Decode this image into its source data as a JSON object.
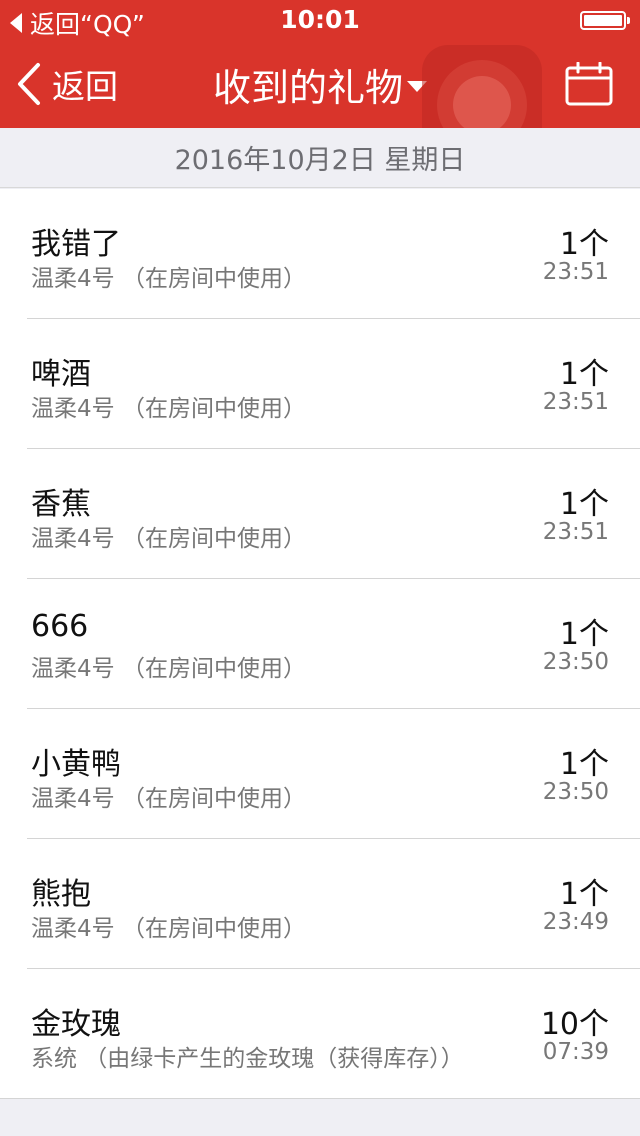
{
  "status_bar": {
    "back_label": "返回“QQ”",
    "time": "10:01"
  },
  "nav": {
    "back_label": "返回",
    "title": "收到的礼物"
  },
  "section": {
    "date": "2016年10月2日 星期日"
  },
  "gifts": [
    {
      "name": "我错了",
      "source": "温柔4号 （在房间中使用）",
      "count": "1个",
      "time": "23:51"
    },
    {
      "name": "啤酒",
      "source": "温柔4号 （在房间中使用）",
      "count": "1个",
      "time": "23:51"
    },
    {
      "name": "香蕉",
      "source": "温柔4号 （在房间中使用）",
      "count": "1个",
      "time": "23:51"
    },
    {
      "name": "666",
      "source": "温柔4号 （在房间中使用）",
      "count": "1个",
      "time": "23:50"
    },
    {
      "name": "小黄鸭",
      "source": "温柔4号 （在房间中使用）",
      "count": "1个",
      "time": "23:50"
    },
    {
      "name": "熊抱",
      "source": "温柔4号 （在房间中使用）",
      "count": "1个",
      "time": "23:49"
    },
    {
      "name": "金玫瑰",
      "source": "系统 （由绿卡产生的金玫瑰（获得库存））",
      "count": "10个",
      "time": "07:39"
    }
  ],
  "colors": {
    "nav_background": "#d9342b",
    "page_background": "#efeff4"
  }
}
